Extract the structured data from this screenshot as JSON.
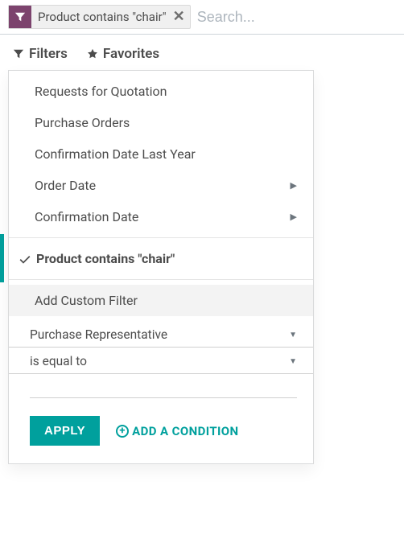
{
  "search": {
    "placeholder": "Search...",
    "facet_label": "Product contains \"chair\""
  },
  "tabs": {
    "filters": "Filters",
    "favorites": "Favorites"
  },
  "filter_options": {
    "rfq": "Requests for Quotation",
    "po": "Purchase Orders",
    "conf_last_year": "Confirmation Date Last Year",
    "order_date": "Order Date",
    "conf_date": "Confirmation Date"
  },
  "active_filter": "Product contains \"chair\"",
  "custom_filter": {
    "header": "Add Custom Filter",
    "field": "Purchase Representative",
    "operator": "is equal to",
    "apply": "APPLY",
    "add_condition": "ADD A CONDITION"
  }
}
